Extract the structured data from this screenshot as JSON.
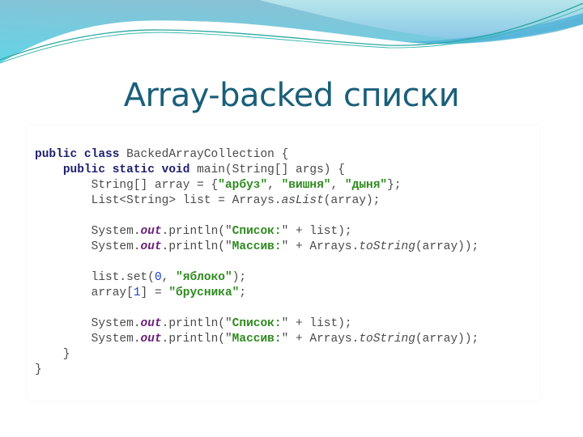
{
  "slide": {
    "title": "Array-backed списки"
  },
  "colors": {
    "title": "#1a5f7a",
    "keyword": "#1f1f6e",
    "string": "#2e8b1e",
    "field": "#6a1e7a",
    "number": "#2040c0",
    "plain": "#4a4a4a"
  },
  "code": {
    "l1": {
      "kw1": "public",
      "kw2": "class",
      "rest": " BackedArrayCollection {"
    },
    "l2": {
      "indent": "    ",
      "kw1": "public",
      "kw2": "static",
      "kw3": "void",
      "rest": " main(String[] args) {"
    },
    "l3": {
      "indent": "        ",
      "pre": "String[] array = {",
      "s1": "\"арбуз\"",
      "sep1": ", ",
      "s2": "\"вишня\"",
      "sep2": ", ",
      "s3": "\"дыня\"",
      "post": "};"
    },
    "l4": {
      "indent": "        ",
      "pre": "List<String> list = Arrays.",
      "method": "asList",
      "post": "(array);"
    },
    "l6": {
      "indent": "        ",
      "pre": "System.",
      "field": "out",
      "mid": ".println(\"",
      "s": "Список:",
      "post": "\" + list);"
    },
    "l7": {
      "indent": "        ",
      "pre": "System.",
      "field": "out",
      "mid": ".println(\"",
      "s": "Массив:",
      "post": "\" + Arrays.",
      "method": "toString",
      "end": "(array));"
    },
    "l9": {
      "indent": "        ",
      "pre": "list.set(",
      "num": "0",
      "sep": ", ",
      "s": "\"яблоко\"",
      "post": ");"
    },
    "l10": {
      "indent": "        ",
      "pre": "array[",
      "num": "1",
      "mid": "] = ",
      "s": "\"брусника\"",
      "post": ";"
    },
    "l12": {
      "indent": "        ",
      "pre": "System.",
      "field": "out",
      "mid": ".println(\"",
      "s": "Список:",
      "post": "\" + list);"
    },
    "l13": {
      "indent": "        ",
      "pre": "System.",
      "field": "out",
      "mid": ".println(\"",
      "s": "Массив:",
      "post": "\" + Arrays.",
      "method": "toString",
      "end": "(array));"
    },
    "l14": {
      "text": "    }"
    },
    "l15": {
      "text": "}"
    }
  }
}
